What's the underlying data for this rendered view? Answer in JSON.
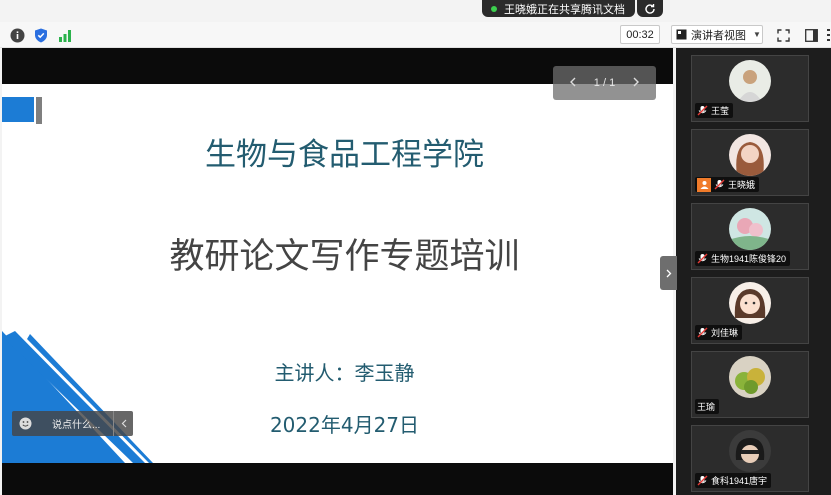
{
  "share_banner": {
    "text": "王晓娥正在共享腾讯文档"
  },
  "toolbar": {
    "timer": "00:32",
    "view_label": "演讲者视图"
  },
  "slide": {
    "pager": "1 / 1",
    "title": "生物与食品工程学院",
    "subtitle": "教研论文写作专题培训",
    "presenter": "主讲人：李玉静",
    "date": "2022年4月27日"
  },
  "chat": {
    "placeholder": "说点什么..."
  },
  "participants": [
    {
      "name": "王莹"
    },
    {
      "name": "王晓娥"
    },
    {
      "name": "生物1941陈俊锋20"
    },
    {
      "name": "刘佳琳"
    },
    {
      "name": "王瑜"
    },
    {
      "name": "食科1941唐宇"
    }
  ],
  "colors": {
    "slide_title": "#235c70",
    "accent_blue": "#1c7cd5",
    "panel_bg": "#1d1d1d"
  }
}
